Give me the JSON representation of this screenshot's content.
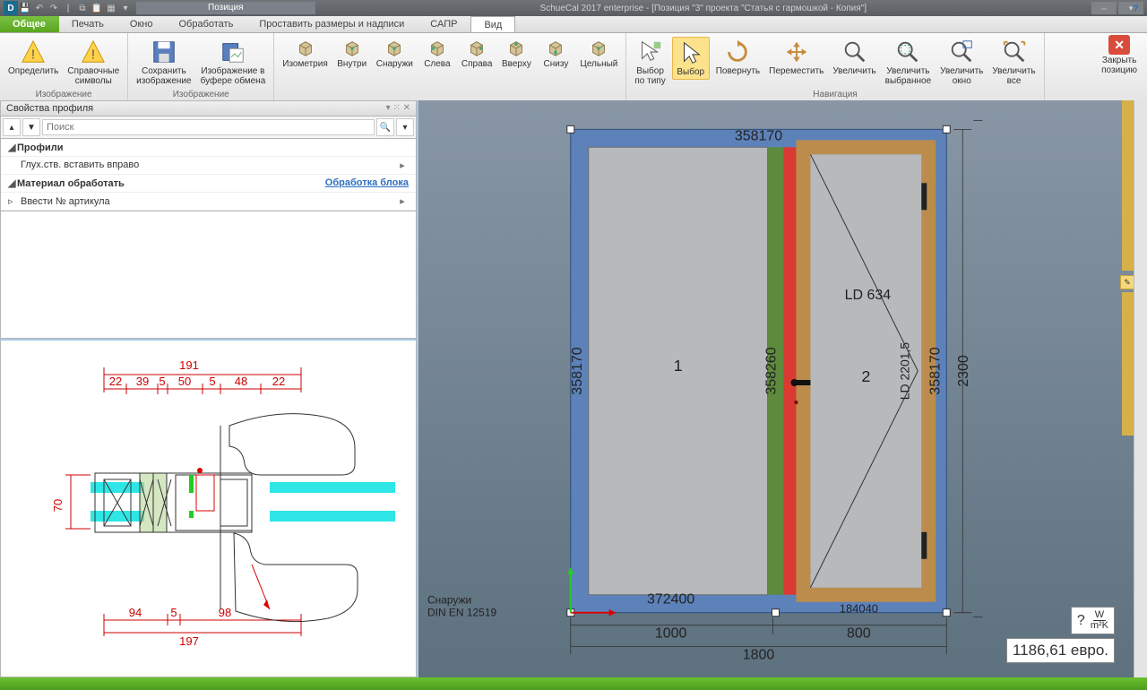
{
  "window": {
    "context_tab": "Позиция",
    "title": "SchueCal 2017 enterprise - [Позиция \"3\" проекта \"Статья с гармошкой - Копия\"]"
  },
  "tabs": {
    "main": "Общее",
    "items": [
      "Печать",
      "Окно",
      "Обработать",
      "Проставить размеры и надписи",
      "САПР"
    ],
    "active": "Вид"
  },
  "ribbon": {
    "g1": {
      "cap": "Изображение",
      "b1": "Определить",
      "b2": "Справочные\nсимволы"
    },
    "g2": {
      "cap": "Изображение",
      "b1": "Сохранить\nизображение",
      "b2": "Изображение в\nбуфере обмена"
    },
    "g3": {
      "cap": "",
      "b": [
        "Изометрия",
        "Внутри",
        "Снаружи",
        "Слева",
        "Справа",
        "Вверху",
        "Снизу",
        "Цельный"
      ]
    },
    "g4": {
      "cap": "Навигация",
      "b1": "Выбор\nпо типу",
      "b2": "Выбор",
      "b3": "Повернуть",
      "b4": "Переместить",
      "b5": "Увеличить",
      "b6": "Увеличить\nвыбранное",
      "b7": "Увеличить\nокно",
      "b8": "Увеличить\nвсе"
    },
    "close": "Закрыть\nпозицию"
  },
  "panel": {
    "title": "Свойства профиля",
    "search_ph": "Поиск",
    "rows": {
      "r1": "Профили",
      "r2": "Глух.ств. вставить вправо",
      "r3": "Материал обработать",
      "r3link": "Обработка блока",
      "r4": "Ввести № артикула"
    }
  },
  "detail": {
    "top_dim": "191",
    "top_seg": [
      "22",
      "39",
      "5",
      "50",
      "5",
      "48",
      "22"
    ],
    "left_dim": "70",
    "bot_seg": [
      "94",
      "5",
      "98"
    ],
    "bot_dim": "197"
  },
  "drawing": {
    "top": "358170",
    "bottom": "372400",
    "mid": "358260",
    "left_h": "358170",
    "right_h": "358170",
    "overall_w": "1800",
    "left_w": "1000",
    "right_w": "800",
    "overall_h": "2300",
    "ld1": "LD 634",
    "ld2": "LD 2201,5",
    "n1": "1",
    "n2": "2",
    "rb": "184040",
    "note1": "Снаружи",
    "note2": "DIN EN 12519"
  },
  "overlays": {
    "uw_q": "?",
    "uw_unit_top": "W",
    "uw_unit_bot": "m²K",
    "price": "1186,61 евро."
  }
}
